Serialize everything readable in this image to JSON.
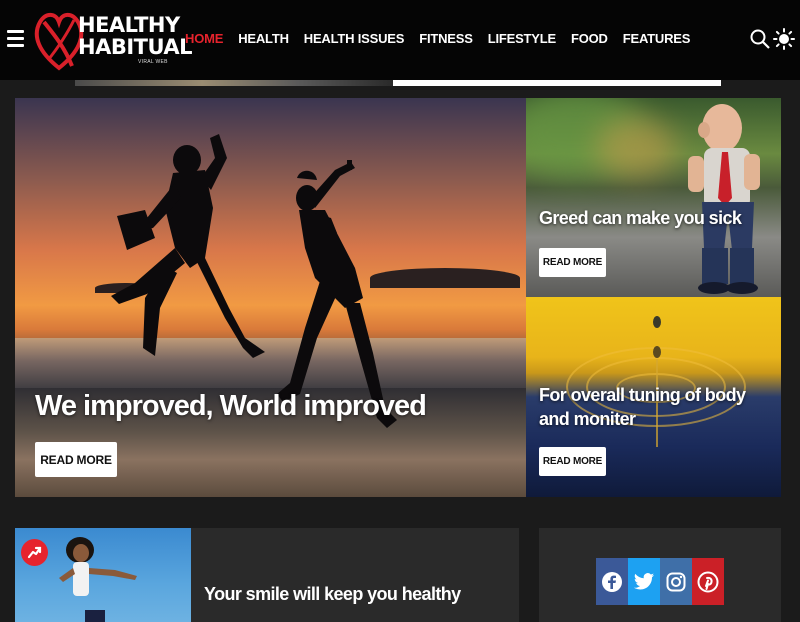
{
  "brand": {
    "line1": "HEALTHY",
    "line2": "HABITUAL",
    "tagline": "VIRAL WEB",
    "accent": "#e6232d"
  },
  "nav": {
    "items": [
      {
        "label": "HOME",
        "active": true
      },
      {
        "label": "HEALTH",
        "active": false
      },
      {
        "label": "HEALTH ISSUES",
        "active": false
      },
      {
        "label": "FITNESS",
        "active": false
      },
      {
        "label": "LIFESTYLE",
        "active": false
      },
      {
        "label": "FOOD",
        "active": false
      },
      {
        "label": "FEATURES",
        "active": false
      }
    ],
    "icons": [
      "menu-icon",
      "search-icon",
      "sun-icon"
    ]
  },
  "featured": {
    "main": {
      "title": "We improved, World improved",
      "button": "READ MORE"
    },
    "side1": {
      "title": "Greed can make you sick",
      "button": "READ MORE"
    },
    "side2": {
      "title": "For overall tuning of body and moniter",
      "button": "READ MORE"
    }
  },
  "posts": [
    {
      "title": "Your smile will keep you healthy",
      "badge_icon": "trending-icon"
    }
  ],
  "social": {
    "icons": [
      "facebook-icon",
      "twitter-icon",
      "instagram-icon",
      "pinterest-icon"
    ],
    "colors": {
      "facebook": "#3b5998",
      "twitter": "#1da1f2",
      "instagram": "#3f6fa8",
      "pinterest": "#cb2027"
    }
  }
}
